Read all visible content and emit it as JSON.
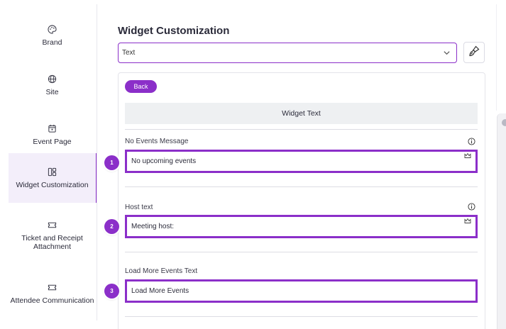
{
  "sidebar": {
    "items": [
      {
        "label": "Brand",
        "icon": "palette-icon"
      },
      {
        "label": "Site",
        "icon": "globe-icon"
      },
      {
        "label": "Event Page",
        "icon": "calendar-icon"
      },
      {
        "label": "Widget Customization",
        "icon": "layout-icon",
        "active": true
      },
      {
        "label": "Ticket and Receipt Attachment",
        "icon": "ticket-icon"
      },
      {
        "label": "Attendee Communication",
        "icon": "ticket-icon"
      }
    ]
  },
  "main": {
    "title": "Widget Customization",
    "select_value": "Text",
    "back_label": "Back",
    "section_title": "Widget Text",
    "fields": [
      {
        "label": "No Events Message",
        "value": "No upcoming events",
        "callout": "1",
        "has_info": true,
        "has_crown": true
      },
      {
        "label": "Host text",
        "value": "Meeting host:",
        "callout": "2",
        "has_info": true,
        "has_crown": true
      },
      {
        "label": "Load More Events Text",
        "value": "Load More Events",
        "callout": "3",
        "has_info": false,
        "has_crown": false
      }
    ]
  },
  "colors": {
    "accent": "#8b2fc9",
    "active_bg": "#f3eefa",
    "header_bg": "#eef0f2"
  }
}
